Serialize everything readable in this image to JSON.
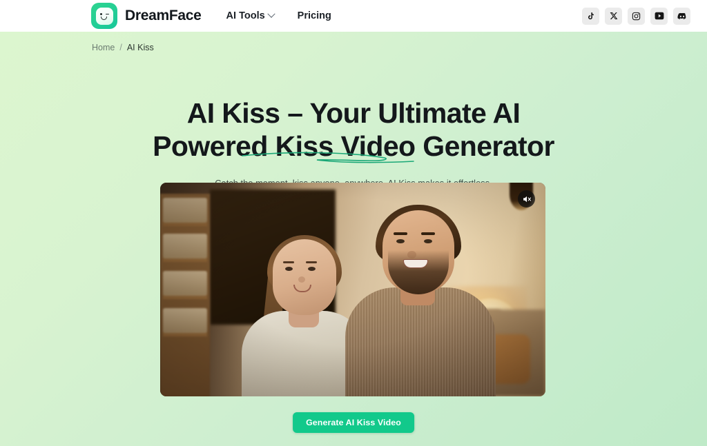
{
  "header": {
    "brand_name": "DreamFace",
    "logo_icon": "dreamface-winking-face-logo",
    "nav": [
      {
        "label": "AI Tools",
        "has_dropdown": true,
        "icon": "chevron-down-icon"
      },
      {
        "label": "Pricing",
        "has_dropdown": false
      }
    ],
    "socials": [
      {
        "name": "tiktok-icon",
        "label": "TikTok"
      },
      {
        "name": "x-twitter-icon",
        "label": "X"
      },
      {
        "name": "instagram-icon",
        "label": "Instagram"
      },
      {
        "name": "youtube-icon",
        "label": "YouTube"
      },
      {
        "name": "discord-icon",
        "label": "Discord"
      }
    ]
  },
  "breadcrumb": {
    "home": "Home",
    "separator": "/",
    "current": "AI Kiss"
  },
  "hero": {
    "title_line1": "AI Kiss – Your Ultimate AI",
    "title_line2": "Powered Kiss Video Generator",
    "subtitle": "Catch the moment, kiss anyone, anywhere. AI Kiss makes it effortless.",
    "underline_accent": "#1aa877"
  },
  "video": {
    "description": "A young smiling couple standing together in a warm cozy living room with bookshelf and lamp",
    "mute_icon": "speaker-muted-icon",
    "muted": true
  },
  "cta": {
    "label": "Generate AI Kiss Video",
    "color": "#12c98b"
  },
  "colors": {
    "page_bg_start": "#ddf6cf",
    "page_bg_end": "#bfeac8",
    "header_bg": "#ffffff",
    "brand_green": "#16c79a",
    "text_dark": "#14181b"
  }
}
